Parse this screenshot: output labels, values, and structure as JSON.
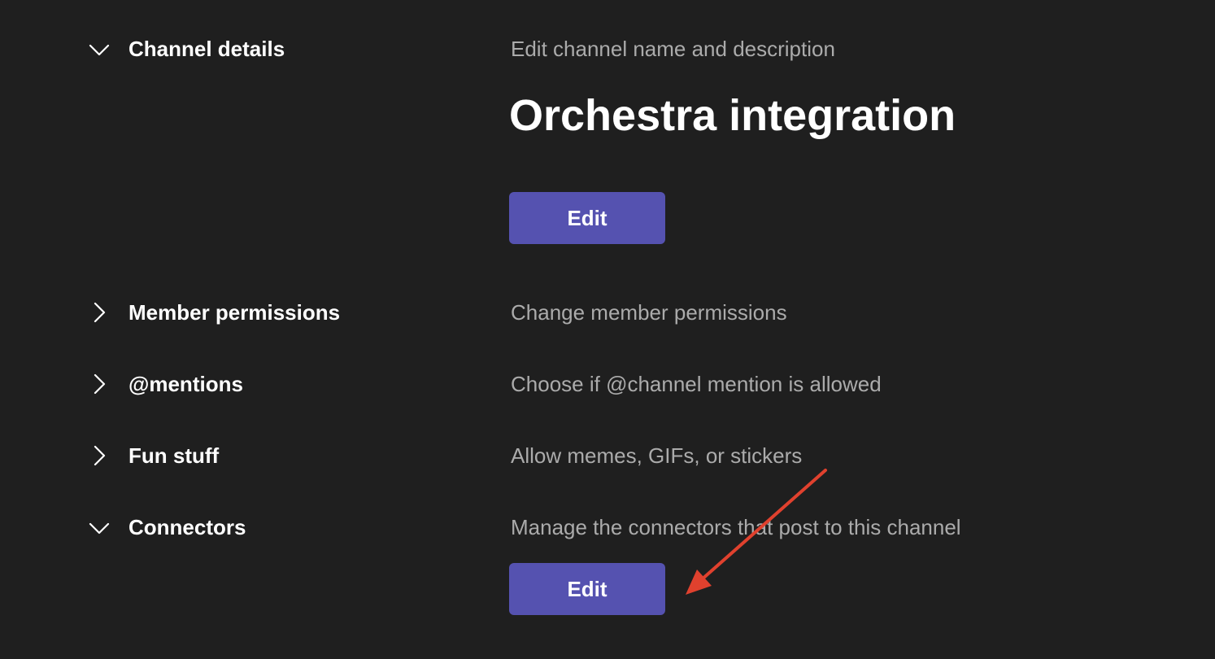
{
  "sections": [
    {
      "title": "Channel details",
      "description": "Edit channel name and description",
      "expanded": true,
      "chevron_icon": "chevron-down-icon"
    },
    {
      "title": "Member permissions",
      "description": "Change member permissions",
      "expanded": false,
      "chevron_icon": "chevron-right-icon"
    },
    {
      "title": "@mentions",
      "description": "Choose if @channel mention is allowed",
      "expanded": false,
      "chevron_icon": "chevron-right-icon"
    },
    {
      "title": "Fun stuff",
      "description": "Allow memes, GIFs, or stickers",
      "expanded": false,
      "chevron_icon": "chevron-right-icon"
    },
    {
      "title": "Connectors",
      "description": "Manage the connectors that post to this channel",
      "expanded": true,
      "chevron_icon": "chevron-down-icon"
    }
  ],
  "channel_details": {
    "channel_name": "Orchestra integration",
    "edit_label": "Edit"
  },
  "connectors": {
    "edit_label": "Edit"
  },
  "colors": {
    "background": "#1f1f1f",
    "button": "#5552b0",
    "annotation_arrow": "#e0412e"
  }
}
